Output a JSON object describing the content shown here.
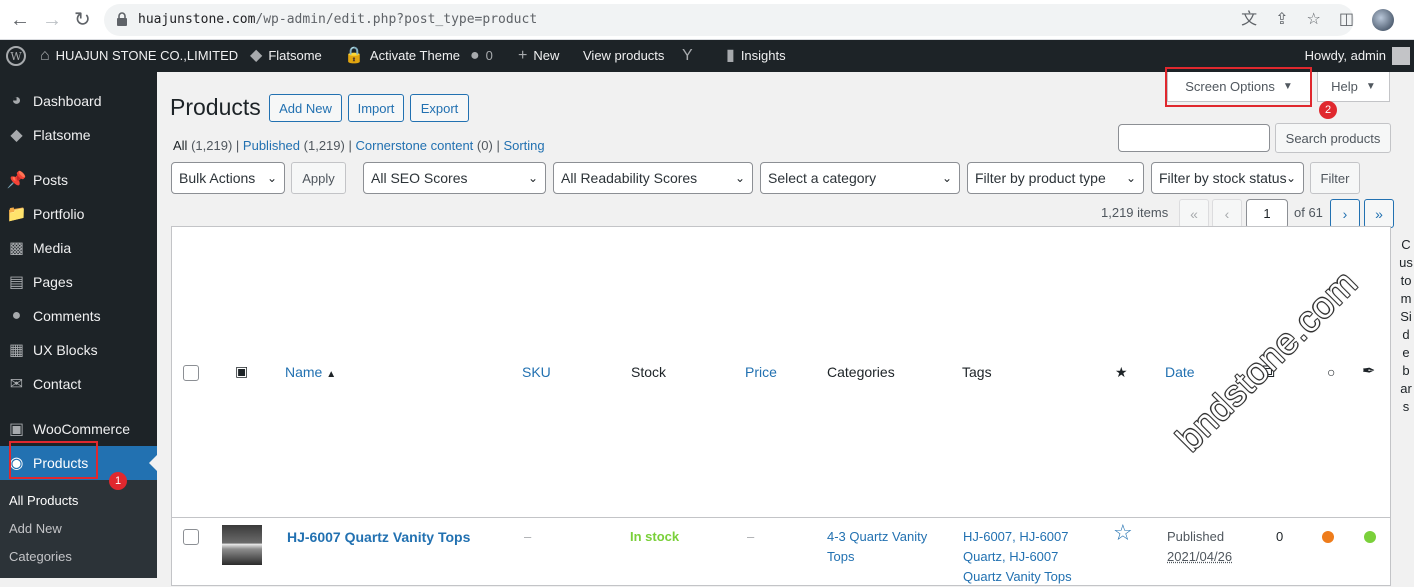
{
  "browser": {
    "url_domain": "huajunstone.com",
    "url_path": "/wp-admin/edit.php?post_type=product"
  },
  "adminbar": {
    "site_name": "HUAJUN STONE CO.,LIMITED",
    "flatsome": "Flatsome",
    "activate_theme": "Activate Theme",
    "comments_count": "0",
    "new": "New",
    "view_products": "View products",
    "insights": "Insights",
    "howdy": "Howdy, admin"
  },
  "sidebar": {
    "items": [
      {
        "label": "Dashboard",
        "icon": "dashboard-icon"
      },
      {
        "label": "Flatsome",
        "icon": "flatsome-icon"
      },
      {
        "label": "Posts",
        "icon": "pin-icon"
      },
      {
        "label": "Portfolio",
        "icon": "folder-icon"
      },
      {
        "label": "Media",
        "icon": "media-icon"
      },
      {
        "label": "Pages",
        "icon": "page-icon"
      },
      {
        "label": "Comments",
        "icon": "comment-icon"
      },
      {
        "label": "UX Blocks",
        "icon": "grid-icon"
      },
      {
        "label": "Contact",
        "icon": "mail-icon"
      },
      {
        "label": "WooCommerce",
        "icon": "woo-icon"
      },
      {
        "label": "Products",
        "icon": "products-icon"
      }
    ],
    "submenu": [
      "All Products",
      "Add New",
      "Categories"
    ]
  },
  "header": {
    "title": "Products",
    "add_new": "Add New",
    "import": "Import",
    "export": "Export",
    "screen_options": "Screen Options",
    "help": "Help"
  },
  "views": {
    "all": "All",
    "all_count": "(1,219)",
    "published": "Published",
    "published_count": "(1,219)",
    "cornerstone": "Cornerstone content",
    "cornerstone_count": "(0)",
    "sorting": "Sorting",
    "sep": "|"
  },
  "search": {
    "button": "Search products"
  },
  "filters": {
    "bulk_actions": "Bulk Actions",
    "apply": "Apply",
    "seo": "All SEO Scores",
    "readability": "All Readability Scores",
    "category": "Select a category",
    "product_type": "Filter by product type",
    "stock_status": "Filter by stock status",
    "filter": "Filter"
  },
  "pagination": {
    "items": "1,219 items",
    "first": "«",
    "prev": "‹",
    "current": "1",
    "of": "of 61",
    "next": "›",
    "last": "»"
  },
  "table": {
    "columns": {
      "name": "Name",
      "sku": "SKU",
      "stock": "Stock",
      "price": "Price",
      "categories": "Categories",
      "tags": "Tags",
      "date": "Date"
    },
    "rows": [
      {
        "name": "HJ-6007 Quartz Vanity Tops",
        "sku": "–",
        "stock": "In stock",
        "price": "–",
        "category_line1": "4-3 Quartz Vanity",
        "category_line2": "Tops",
        "tags_line1": "HJ-6007, HJ-6007",
        "tags_line2": "Quartz, HJ-6007",
        "tags_line3": "Quartz Vanity Tops",
        "status": "Published",
        "date": "2021/04/26",
        "count": "0"
      }
    ]
  },
  "custom_sidebars": "CustomSidebars",
  "watermark": "bndstone.com",
  "annotations": {
    "badge1": "1",
    "badge2": "2"
  },
  "colors": {
    "admin_dark": "#1d2327",
    "link_blue": "#2271b1",
    "in_stock_green": "#7ad03a",
    "annotation_red": "#e0282e",
    "seo_orange": "#ee7c1b",
    "readability_green": "#7ad03a"
  }
}
